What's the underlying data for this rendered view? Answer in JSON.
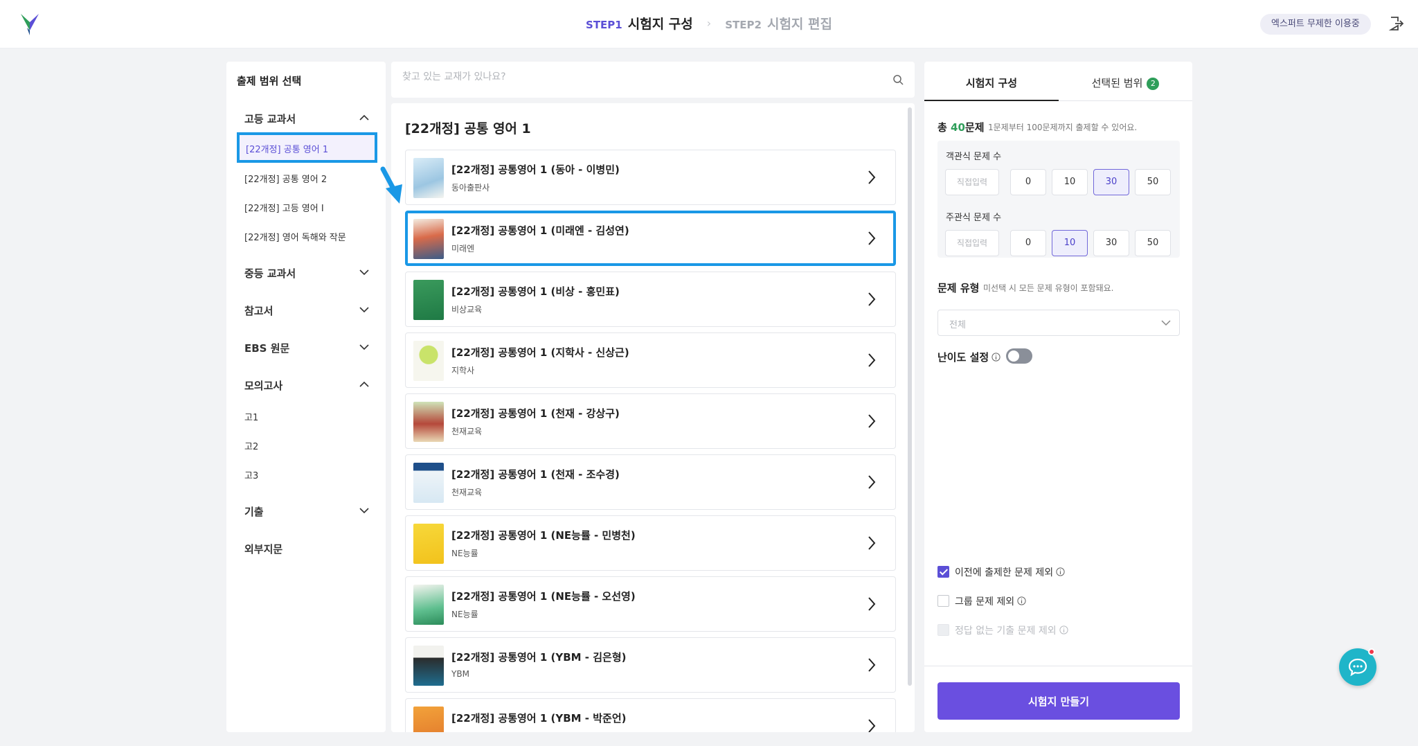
{
  "header": {
    "step1_num": "STEP1",
    "step1_title": "시험지 구성",
    "step2_num": "STEP2",
    "step2_title": "시험지 편집",
    "user_badge": "엑스퍼트 무제한 이용중"
  },
  "sidebar": {
    "title": "출제 범위 선택",
    "categories": [
      {
        "label": "고등 교과서",
        "expanded": true
      },
      {
        "label": "중등 교과서",
        "expanded": false
      },
      {
        "label": "참고서",
        "expanded": false
      },
      {
        "label": "EBS 원문",
        "expanded": false
      },
      {
        "label": "모의고사",
        "expanded": true
      },
      {
        "label": "기출",
        "expanded": false
      },
      {
        "label": "외부지문",
        "expanded": false
      }
    ],
    "high_items": [
      "[22개정] 공통 영어 1",
      "[22개정] 공통 영어 2",
      "[22개정] 고등 영어 I",
      "[22개정] 영어 독해와 작문"
    ],
    "mock_items": [
      "고1",
      "고2",
      "고3"
    ]
  },
  "search": {
    "placeholder": "찾고 있는 교재가 있나요?"
  },
  "list": {
    "title": "[22개정] 공통 영어 1",
    "books": [
      {
        "title": "[22개정] 공통영어 1 (동아 - 이병민)",
        "publisher": "동아출판사"
      },
      {
        "title": "[22개정] 공통영어 1 (미래엔 - 김성연)",
        "publisher": "미래엔"
      },
      {
        "title": "[22개정] 공통영어 1 (비상 - 홍민표)",
        "publisher": "비상교육"
      },
      {
        "title": "[22개정] 공통영어 1 (지학사 - 신상근)",
        "publisher": "지학사"
      },
      {
        "title": "[22개정] 공통영어 1 (천재 - 강상구)",
        "publisher": "천재교육"
      },
      {
        "title": "[22개정] 공통영어 1 (천재 - 조수경)",
        "publisher": "천재교육"
      },
      {
        "title": "[22개정] 공통영어 1 (NE능률 - 민병천)",
        "publisher": "NE능률"
      },
      {
        "title": "[22개정] 공통영어 1 (NE능률 - 오선영)",
        "publisher": "NE능률"
      },
      {
        "title": "[22개정] 공통영어 1 (YBM - 김은형)",
        "publisher": "YBM"
      },
      {
        "title": "[22개정] 공통영어 1 (YBM - 박준언)",
        "publisher": ""
      }
    ]
  },
  "config": {
    "tab_config": "시험지 구성",
    "tab_range": "선택된 범위",
    "tab_range_count": "2",
    "total_prefix": "총",
    "total_num": "40",
    "total_suffix": "문제",
    "total_hint": "1문제부터 100문제까지 출제할 수 있어요.",
    "objective_label": "객관식 문제 수",
    "subjective_label": "주관식 문제 수",
    "direct_input": "직접입력",
    "options": [
      "0",
      "10",
      "30",
      "50"
    ],
    "objective_selected": "30",
    "subjective_selected": "10",
    "qtype_label": "문제 유형",
    "qtype_hint": "미선택 시 모든 문제 유형이 포함돼요.",
    "qtype_value": "전체",
    "difficulty_label": "난이도 설정",
    "exclude_prev": "이전에 출제한 문제 제외",
    "exclude_group": "그룹 문제 제외",
    "exclude_no_answer": "정답 없는 기출 문제 제외",
    "make_button": "시험지 만들기"
  },
  "colors": {
    "accent": "#6a4fe0",
    "highlight": "#1a98e6",
    "green": "#2f9e5a"
  }
}
